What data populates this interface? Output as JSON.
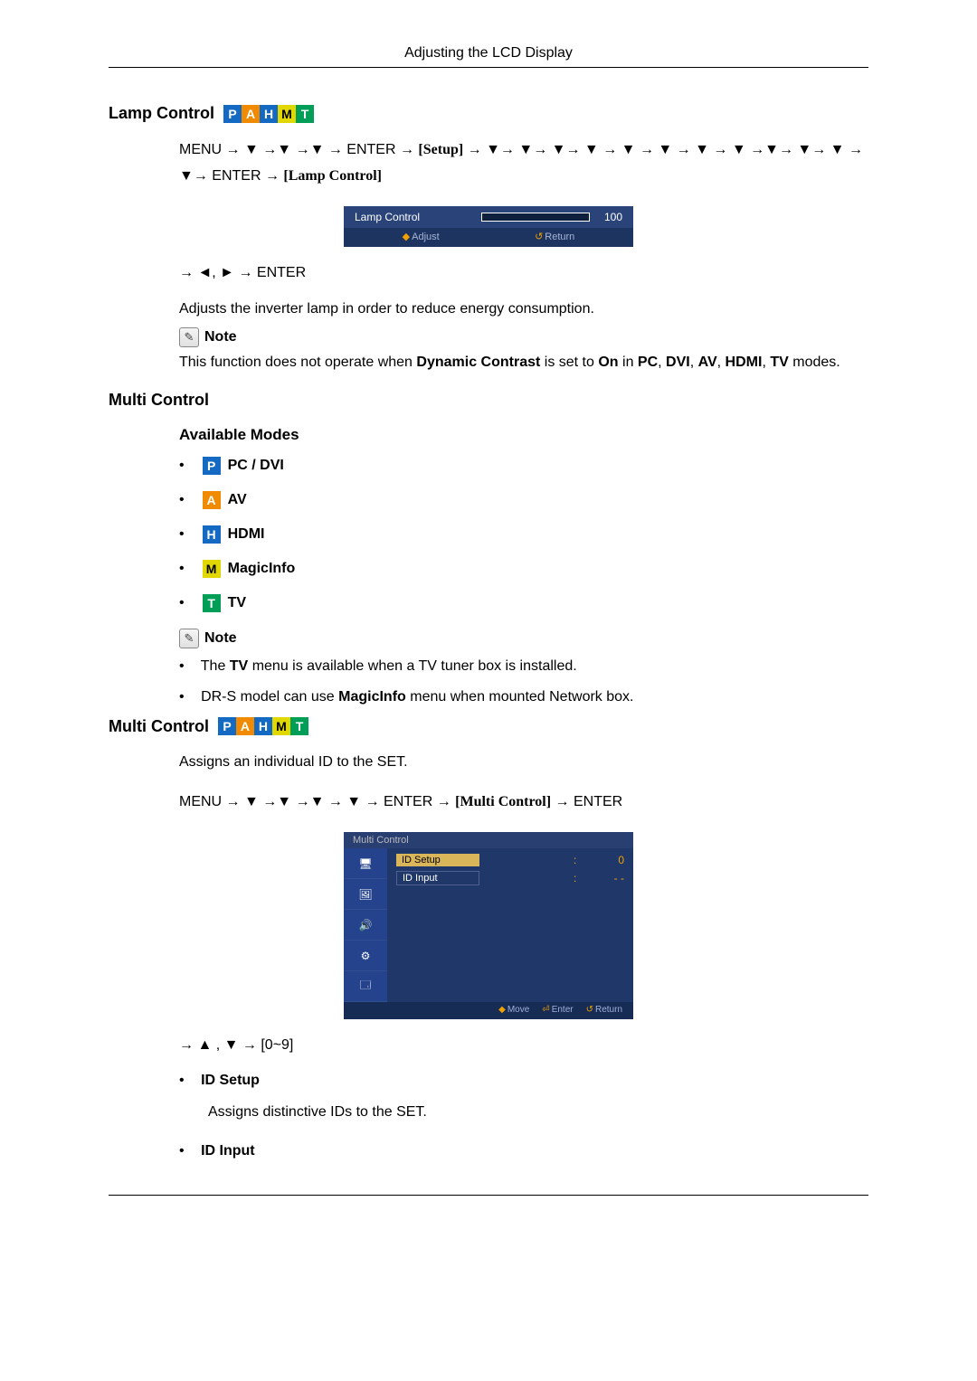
{
  "page_header": "Adjusting the LCD Display",
  "lamp_control": {
    "heading": "Lamp Control",
    "menu_path_1": "MENU → ▼ →▼ →▼ → ENTER → ",
    "menu_path_setup": "[Setup]",
    "menu_path_2": " → ▼→ ▼→ ▼→ ▼ → ▼ → ▼ → ▼ → ▼ →▼→ ▼→ ▼ → ▼→ ENTER → ",
    "menu_path_lamp": "[Lamp Control]",
    "ui_label": "Lamp Control",
    "ui_value": "100",
    "ui_adjust": "Adjust",
    "ui_return": "Return",
    "nav_lr": "→ ◄, ► → ENTER",
    "desc": "Adjusts the inverter lamp in order to reduce energy consumption.",
    "note_label": "Note",
    "note_body_prefix": "This function does not operate when ",
    "note_dc": "Dynamic Contrast",
    "note_mid": " is set to ",
    "note_on": "On",
    "note_in": " in ",
    "note_pc": "PC",
    "note_dvi": "DVI",
    "note_av": "AV",
    "note_hdmi": "HDMI",
    "note_tv": "TV",
    "note_suffix": " modes."
  },
  "multi_control_modes": {
    "heading": "Multi Control",
    "sub_heading": "Available Modes",
    "modes": {
      "p_letter": "P",
      "p_label": "PC / DVI",
      "a_letter": "A",
      "a_label": "AV",
      "h_letter": "H",
      "h_label": "HDMI",
      "m_letter": "M",
      "m_label": "MagicInfo",
      "t_letter": "T",
      "t_label": "TV"
    },
    "note_label": "Note",
    "note_items": {
      "tv_prefix": "The ",
      "tv_bold": "TV",
      "tv_suffix": " menu is available when a TV tuner box is installed.",
      "dr_prefix": "DR-S model can use ",
      "dr_bold": "MagicInfo",
      "dr_suffix": " menu when mounted Network box."
    }
  },
  "multi_control_section": {
    "heading": "Multi Control",
    "intro": "Assigns an individual ID to the SET.",
    "menu_path_1": "MENU → ▼ →▼ →▼ → ▼ → ENTER → ",
    "menu_path_mc": "[Multi Control]",
    "menu_path_2": "→ ENTER",
    "ui_title": "Multi Control",
    "ui_id_setup": "ID  Setup",
    "ui_id_setup_val": "0",
    "ui_id_input": "ID  Input",
    "ui_id_input_val": "- -",
    "ui_move": "Move",
    "ui_enter": "Enter",
    "ui_return": "Return",
    "nav_ud": "→ ▲ , ▼ → [0~9]",
    "id_setup_label": "ID Setup",
    "id_setup_desc": "Assigns distinctive IDs to the SET.",
    "id_input_label": "ID Input"
  },
  "badges": {
    "p": "P",
    "a": "A",
    "h": "H",
    "m": "M",
    "t": "T"
  }
}
